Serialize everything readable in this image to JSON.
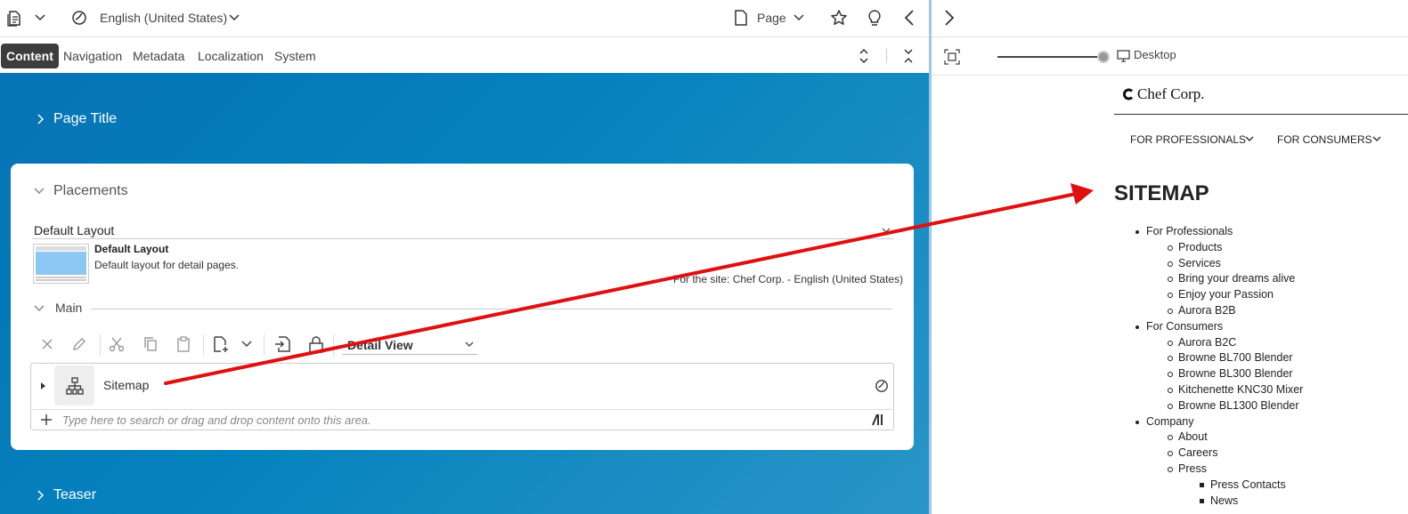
{
  "topbar": {
    "locale": "English (United States)",
    "page_type": "Page"
  },
  "tabs": [
    {
      "label": "Content"
    },
    {
      "label": "Navigation"
    },
    {
      "label": "Metadata"
    },
    {
      "label": "Localization"
    },
    {
      "label": "System"
    }
  ],
  "sections": {
    "page_title": "Page Title",
    "placements": "Placements",
    "teaser": "Teaser"
  },
  "layout": {
    "field_label": "Default Layout",
    "name": "Default Layout",
    "description": "Default layout for detail pages.",
    "site_note": "For the site: Chef Corp. - English (United States)"
  },
  "main": {
    "label": "Main",
    "view_select": "Detail View",
    "item_label": "Sitemap",
    "drop_placeholder": "Type here to search or drag and drop content onto this area."
  },
  "preview": {
    "device": "Desktop",
    "brand": "Chef Corp.",
    "nav": [
      {
        "label": "FOR PROFESSIONALS"
      },
      {
        "label": "FOR CONSUMERS"
      }
    ],
    "heading": "SITEMAP",
    "sitemap": [
      {
        "label": "For Professionals",
        "children": [
          {
            "label": "Products"
          },
          {
            "label": "Services"
          },
          {
            "label": "Bring your dreams alive"
          },
          {
            "label": "Enjoy your Passion"
          },
          {
            "label": "Aurora B2B"
          }
        ]
      },
      {
        "label": "For Consumers",
        "children": [
          {
            "label": "Aurora B2C"
          },
          {
            "label": "Browne BL700 Blender"
          },
          {
            "label": "Browne BL300 Blender"
          },
          {
            "label": "Kitchenette KNC30 Mixer"
          },
          {
            "label": "Browne BL1300 Blender"
          }
        ]
      },
      {
        "label": "Company",
        "children": [
          {
            "label": "About"
          },
          {
            "label": "Careers"
          },
          {
            "label": "Press"
          }
        ]
      },
      {
        "label": "Press Contacts",
        "children": []
      },
      {
        "label": "News",
        "children": []
      }
    ]
  },
  "colors": {
    "accent_blue": "#0578b7",
    "annotation_red": "#e01010",
    "active_tab": "#3d3d3d",
    "layout_thumb": "#8cc8f2"
  }
}
